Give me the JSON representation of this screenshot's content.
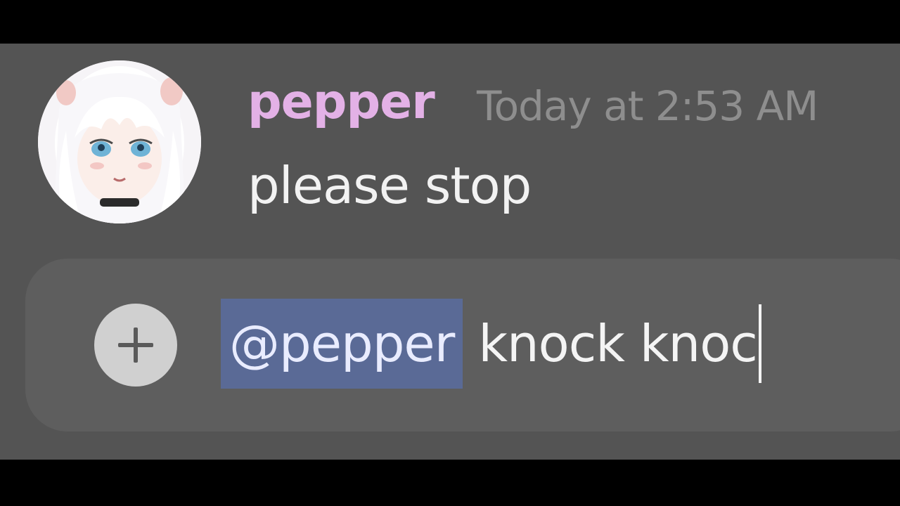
{
  "message": {
    "author": "pepper",
    "timestamp": "Today at 2:53 AM",
    "text": "please stop",
    "avatar_icon": "anime-avatar-white-hair"
  },
  "composer": {
    "attach_icon": "plus-icon",
    "mention": "@pepper",
    "typed_text": "knock knoc"
  },
  "colors": {
    "background": "#000000",
    "panel": "#545454",
    "username": "#e3b1e6",
    "timestamp": "#8e8e8e",
    "mention_highlight": "#5a6a96",
    "text": "#f2f2f2"
  }
}
